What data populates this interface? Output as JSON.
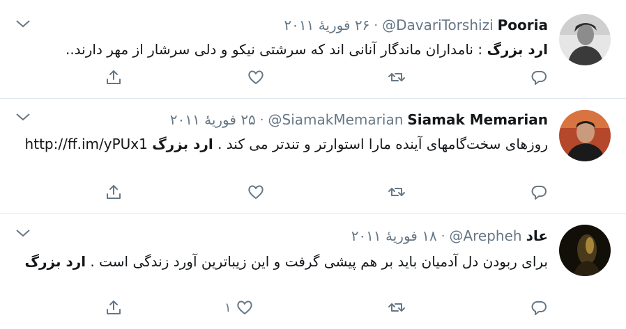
{
  "tweets": [
    {
      "name": "Pooria",
      "handle": "@DavariTorshizi",
      "separator": "·",
      "date": "۲۶ فوریهٔ ۲۰۱۱",
      "hashtag": "ارد بزرگ",
      "text_before": "",
      "text_after": " : نامداران ماندگار آنانی اند که سرشتی نیکو و دلی سرشار از مهر دارند..",
      "like_count": "",
      "avatar_colors": [
        "#d9d9d9",
        "#3a3a3a"
      ]
    },
    {
      "name": "Siamak Memarian",
      "handle": "@SiamakMemarian",
      "separator": "·",
      "date": "۲۵ فوریهٔ ۲۰۱۱",
      "text_before": "روزهای سخت‌گامهای آینده مارا استوارتر و تندتر می کند . ",
      "hashtag": "ارد بزرگ",
      "text_after": " ",
      "link": "http://ff.im/yPUx1",
      "like_count": "",
      "avatar_colors": [
        "#c9542f",
        "#1d1d1d"
      ]
    },
    {
      "name": "عاد",
      "handle": "@Arepheh",
      "separator": "·",
      "date": "۱۸ فوریهٔ ۲۰۱۱",
      "text_before": "برای ربودن دل آدمیان باید بر هم پیشی گرفت و این  زیباترین آورد زندگی است . ",
      "hashtag": "ارد بزرگ",
      "text_after": "",
      "like_count": "۱",
      "avatar_colors": [
        "#8a6a2a",
        "#0d0b07"
      ]
    }
  ],
  "colors": {
    "text": "#14171a",
    "secondary": "#657786",
    "divider": "#e1e8ed"
  },
  "icons": [
    "reply-icon",
    "retweet-icon",
    "like-icon",
    "share-icon",
    "caret-down-icon"
  ]
}
